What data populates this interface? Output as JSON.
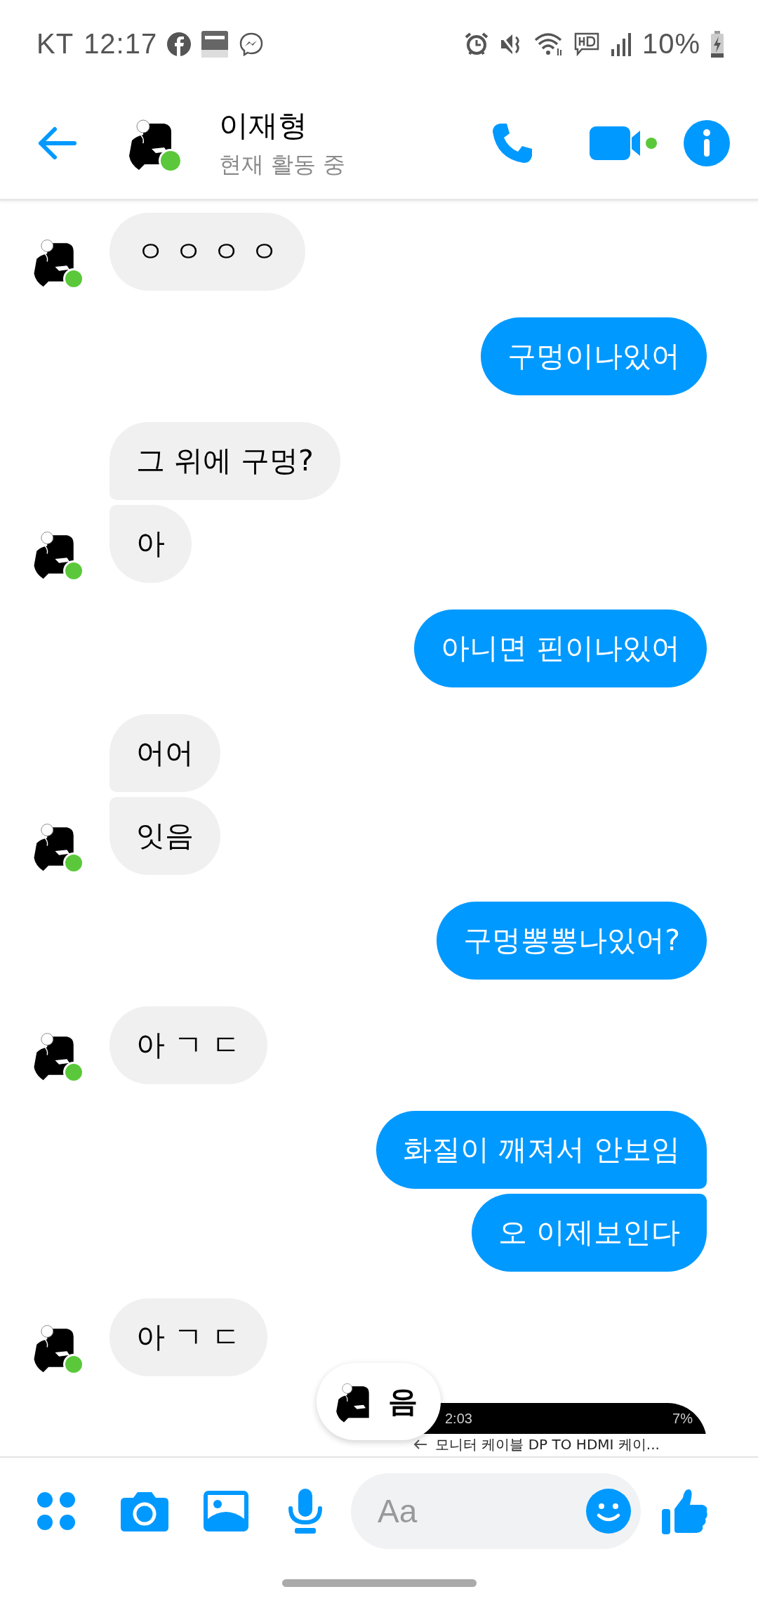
{
  "status_bar": {
    "carrier": "KT",
    "time": "12:17",
    "battery": "10%"
  },
  "header": {
    "name": "이재형",
    "status": "현재 활동 중",
    "online": true
  },
  "messages": [
    {
      "kind": "incoming",
      "texts": [
        "ㅇ ㅇ ㅇ ㅇ"
      ]
    },
    {
      "kind": "outgoing",
      "texts": [
        "구멍이나있어"
      ]
    },
    {
      "kind": "incoming",
      "texts": [
        "그 위에 구멍?",
        "아"
      ]
    },
    {
      "kind": "outgoing",
      "texts": [
        "아니면 핀이나있어"
      ]
    },
    {
      "kind": "incoming",
      "texts": [
        "어어",
        "잇음"
      ]
    },
    {
      "kind": "outgoing",
      "texts": [
        "구멍뽕뽕나있어?"
      ]
    },
    {
      "kind": "incoming",
      "texts": [
        "아 ㄱ ㄷ"
      ]
    },
    {
      "kind": "outgoing",
      "texts": [
        "화질이 깨져서 안보임",
        "오 이제보인다"
      ]
    },
    {
      "kind": "incoming",
      "texts": [
        "아 ㄱ ㄷ"
      ]
    }
  ],
  "shared_image": {
    "time": "2:03",
    "battery": "7%",
    "title": "모니터 케이블 DP TO HDMI 케이..."
  },
  "preview": {
    "text": "음"
  },
  "composer": {
    "placeholder": "Aa"
  }
}
